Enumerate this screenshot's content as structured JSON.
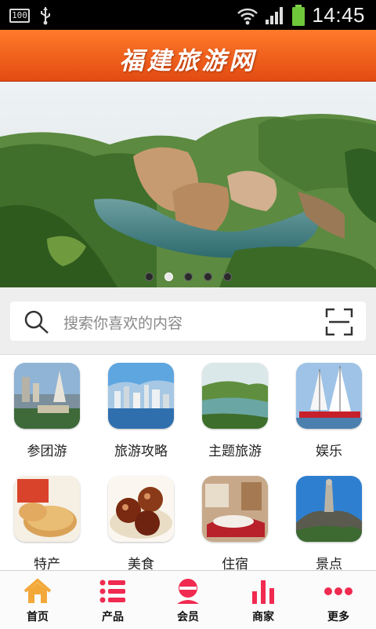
{
  "status_bar": {
    "battery_level": "100",
    "time": "14:45"
  },
  "header": {
    "title": "福建旅游网"
  },
  "banner": {
    "slide_count": 5,
    "active_slide": 2
  },
  "search": {
    "placeholder": "搜索你喜欢的内容"
  },
  "categories": [
    {
      "label": "参团游",
      "icon": "city-tower-photo"
    },
    {
      "label": "旅游攻略",
      "icon": "skyline-photo"
    },
    {
      "label": "主题旅游",
      "icon": "lake-hills-photo"
    },
    {
      "label": "娱乐",
      "icon": "sailboat-photo"
    },
    {
      "label": "特产",
      "icon": "pastry-photo"
    },
    {
      "label": "美食",
      "icon": "dumplings-photo"
    },
    {
      "label": "住宿",
      "icon": "hotel-room-photo"
    },
    {
      "label": "景点",
      "icon": "statue-rock-photo"
    }
  ],
  "tabbar": {
    "items": [
      {
        "label": "首页",
        "icon": "home-icon"
      },
      {
        "label": "产品",
        "icon": "list-icon"
      },
      {
        "label": "会员",
        "icon": "member-icon"
      },
      {
        "label": "商家",
        "icon": "bar-chart-icon"
      },
      {
        "label": "更多",
        "icon": "more-dots-icon"
      }
    ]
  },
  "colors": {
    "header_orange": "#ff7a2a",
    "accent_red": "#f02a50",
    "home_icon_orange": "#f3a93a"
  }
}
